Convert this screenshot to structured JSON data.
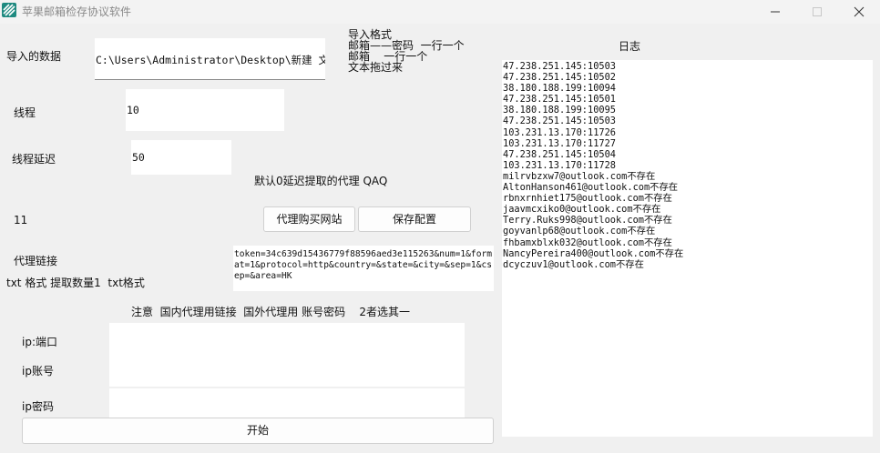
{
  "window": {
    "title": "苹果邮箱检存协议软件",
    "icon": "app-logo-icon"
  },
  "import_data": {
    "label": "导入的数据",
    "value": "C:\\Users\\Administrator\\Desktop\\新建 文本文"
  },
  "import_format": {
    "title": "导入格式",
    "line1": "邮箱——密码  一行一个",
    "line2": "邮箱    一行一个",
    "line3": "文本拖过来"
  },
  "threads": {
    "label": "线程",
    "value": "10"
  },
  "thread_delay": {
    "label": "线程延迟",
    "value": "50"
  },
  "default_note": "默认0延迟提取的代理  QAQ",
  "count": "11",
  "buttons": {
    "buy_proxy": "代理购买网站",
    "save_config": "保存配置",
    "start": "开始"
  },
  "proxy_link": {
    "label": "代理链接",
    "value": "token=34c639d15436779f88596aed3e115263&num=1&format=1&protocol=http&country=&state=&city=&sep=1&csep=&area=HK"
  },
  "txt_note": "txt 格式 提取数量1  txt格式",
  "notice": "注意  国内代理用链接  国外代理用 账号密码    2者选其一",
  "ip_port": {
    "label": "ip:端口",
    "value": ""
  },
  "ip_account": {
    "label": "ip账号",
    "value": ""
  },
  "ip_password": {
    "label": "ip密码",
    "value": ""
  },
  "log": {
    "title": "日志",
    "lines": [
      "47.238.251.145:10503",
      "47.238.251.145:10502",
      "38.180.188.199:10094",
      "47.238.251.145:10501",
      "38.180.188.199:10095",
      "47.238.251.145:10503",
      "103.231.13.170:11726",
      "103.231.13.170:11727",
      "47.238.251.145:10504",
      "103.231.13.170:11728",
      "milrvbzxw7@outlook.com不存在",
      "AltonHanson461@outlook.com不存在",
      "rbnxrnhiet175@outlook.com不存在",
      "jaavmcxiko0@outlook.com不存在",
      "Terry.Ruks998@outlook.com不存在",
      "goyvanlp68@outlook.com不存在",
      "fhbamxblxk032@outlook.com不存在",
      "NancyPereira400@outlook.com不存在",
      "dcyczuv1@outlook.com不存在"
    ]
  }
}
